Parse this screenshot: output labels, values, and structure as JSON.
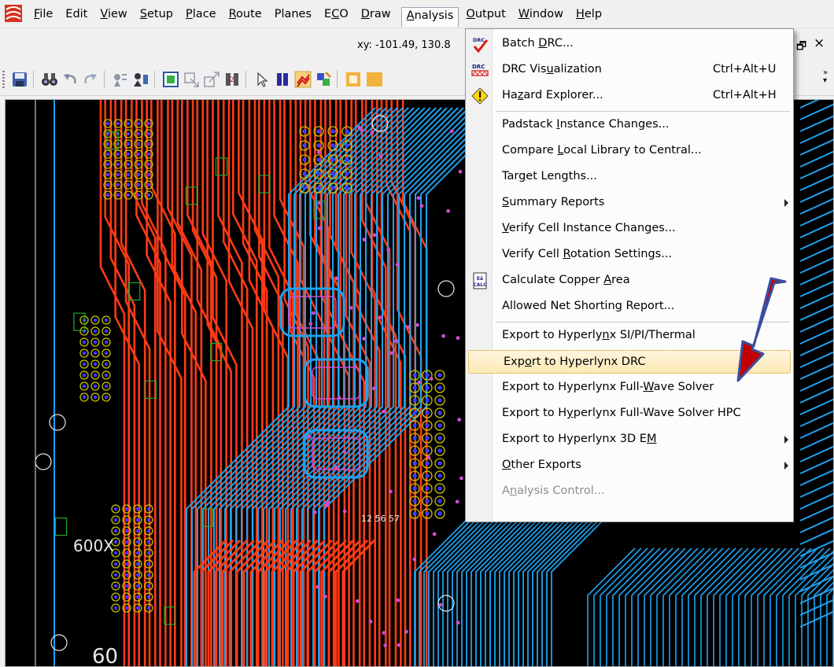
{
  "menubar": {
    "items": [
      {
        "pre": "",
        "mn": "F",
        "post": "ile"
      },
      {
        "pre": "Edit",
        "mn": "",
        "post": ""
      },
      {
        "pre": "",
        "mn": "V",
        "post": "iew"
      },
      {
        "pre": "",
        "mn": "S",
        "post": "etup"
      },
      {
        "pre": "",
        "mn": "P",
        "post": "lace"
      },
      {
        "pre": "",
        "mn": "R",
        "post": "oute"
      },
      {
        "pre": "Planes",
        "mn": "",
        "post": ""
      },
      {
        "pre": "E",
        "mn": "C",
        "post": "O"
      },
      {
        "pre": "",
        "mn": "D",
        "post": "raw"
      },
      {
        "pre": "",
        "mn": "A",
        "post": "nalysis"
      },
      {
        "pre": "",
        "mn": "O",
        "post": "utput"
      },
      {
        "pre": "",
        "mn": "W",
        "post": "indow"
      },
      {
        "pre": "",
        "mn": "H",
        "post": "elp"
      }
    ],
    "active_index": 9
  },
  "status": {
    "xy": "xy: -101.49, 130.8"
  },
  "icons": {
    "restore": "restore-window-icon",
    "close": "close-icon",
    "restore_glyph": "🗗",
    "close_glyph": "×",
    "overflow_glyph": "»"
  },
  "analysis_menu": {
    "items": [
      {
        "name": "batch-drc",
        "icon": "drc-check-icon",
        "pre": "Batch ",
        "mn": "D",
        "post": "RC...",
        "shortcut": "",
        "submenu": false
      },
      {
        "name": "drc-visualization",
        "icon": "drc-visualization-icon",
        "pre": "DRC Vis",
        "mn": "u",
        "post": "alization",
        "shortcut": "Ctrl+Alt+U",
        "submenu": false
      },
      {
        "name": "hazard-explorer",
        "icon": "hazard-icon",
        "pre": "Ha",
        "mn": "z",
        "post": "ard Explorer...",
        "shortcut": "Ctrl+Alt+H",
        "submenu": false,
        "sep_after": true
      },
      {
        "name": "padstack-instance-changes",
        "icon": "",
        "pre": "Padstack ",
        "mn": "I",
        "post": "nstance Changes...",
        "shortcut": "",
        "submenu": false
      },
      {
        "name": "compare-local-library",
        "icon": "",
        "pre": "Compare ",
        "mn": "L",
        "post": "ocal Library to Central...",
        "shortcut": "",
        "submenu": false
      },
      {
        "name": "target-lengths",
        "icon": "",
        "pre": "Tar",
        "mn": "g",
        "post": "et Lengths...",
        "shortcut": "",
        "submenu": false
      },
      {
        "name": "summary-reports",
        "icon": "",
        "pre": "",
        "mn": "S",
        "post": "ummary Reports",
        "shortcut": "",
        "submenu": true
      },
      {
        "name": "verify-cell-instance-changes",
        "icon": "",
        "pre": "",
        "mn": "V",
        "post": "erify Cell Instance Changes...",
        "shortcut": "",
        "submenu": false
      },
      {
        "name": "verify-cell-rotation-settings",
        "icon": "",
        "pre": "Verify Cell ",
        "mn": "R",
        "post": "otation Settings...",
        "shortcut": "",
        "submenu": false
      },
      {
        "name": "calculate-copper-area",
        "icon": "calc-icon",
        "pre": "Calculate Copper ",
        "mn": "A",
        "post": "rea",
        "shortcut": "",
        "submenu": false
      },
      {
        "name": "allowed-net-shorting-report",
        "icon": "",
        "pre": "Allowed Net Shortin",
        "mn": "g",
        "post": " Report...",
        "shortcut": "",
        "submenu": false,
        "sep_after": true
      },
      {
        "name": "export-hyperlynx-si-pi-thermal",
        "icon": "",
        "pre": "Export to Hyperly",
        "mn": "n",
        "post": "x SI/PI/Thermal",
        "shortcut": "",
        "submenu": false
      },
      {
        "name": "export-hyperlynx-drc",
        "icon": "",
        "pre": "Exp",
        "mn": "o",
        "post": "rt to Hyperlynx DRC",
        "shortcut": "",
        "submenu": false,
        "highlighted": true
      },
      {
        "name": "export-hyperlynx-full-wave-solver",
        "icon": "",
        "pre": "Export to Hyperlynx Full-",
        "mn": "W",
        "post": "ave Solver",
        "shortcut": "",
        "submenu": false
      },
      {
        "name": "export-hyperlynx-full-wave-solver-hpc",
        "icon": "",
        "pre": "Export to H",
        "mn": "y",
        "post": "perlynx Full-Wave Solver HPC",
        "shortcut": "",
        "submenu": false
      },
      {
        "name": "export-hyperlynx-3d-em",
        "icon": "",
        "pre": "Export to Hyperlynx 3D E",
        "mn": "M",
        "post": "",
        "shortcut": "",
        "submenu": true
      },
      {
        "name": "other-exports",
        "icon": "",
        "pre": "",
        "mn": "O",
        "post": "ther Exports",
        "shortcut": "",
        "submenu": true
      },
      {
        "name": "analysis-control",
        "icon": "",
        "pre": "A",
        "mn": "n",
        "post": "alysis Control...",
        "shortcut": "",
        "submenu": false,
        "disabled": true
      }
    ]
  },
  "canvas": {
    "labels": [
      "600X",
      "12 56 57",
      "60"
    ],
    "colors": {
      "background": "#000000",
      "top_copper": "#ff3b16",
      "bottom_copper": "#1ea2f0",
      "inner_copper": "#3a3aff",
      "silk": "#39c9d4",
      "outline": "#e8e8e8",
      "pads": "#c9c300",
      "magenta": "#d04cd0",
      "green": "#1eaa2a"
    }
  },
  "annotation": {
    "arrow_color": "#c00000",
    "arrow_outline": "#3b4fa0"
  }
}
